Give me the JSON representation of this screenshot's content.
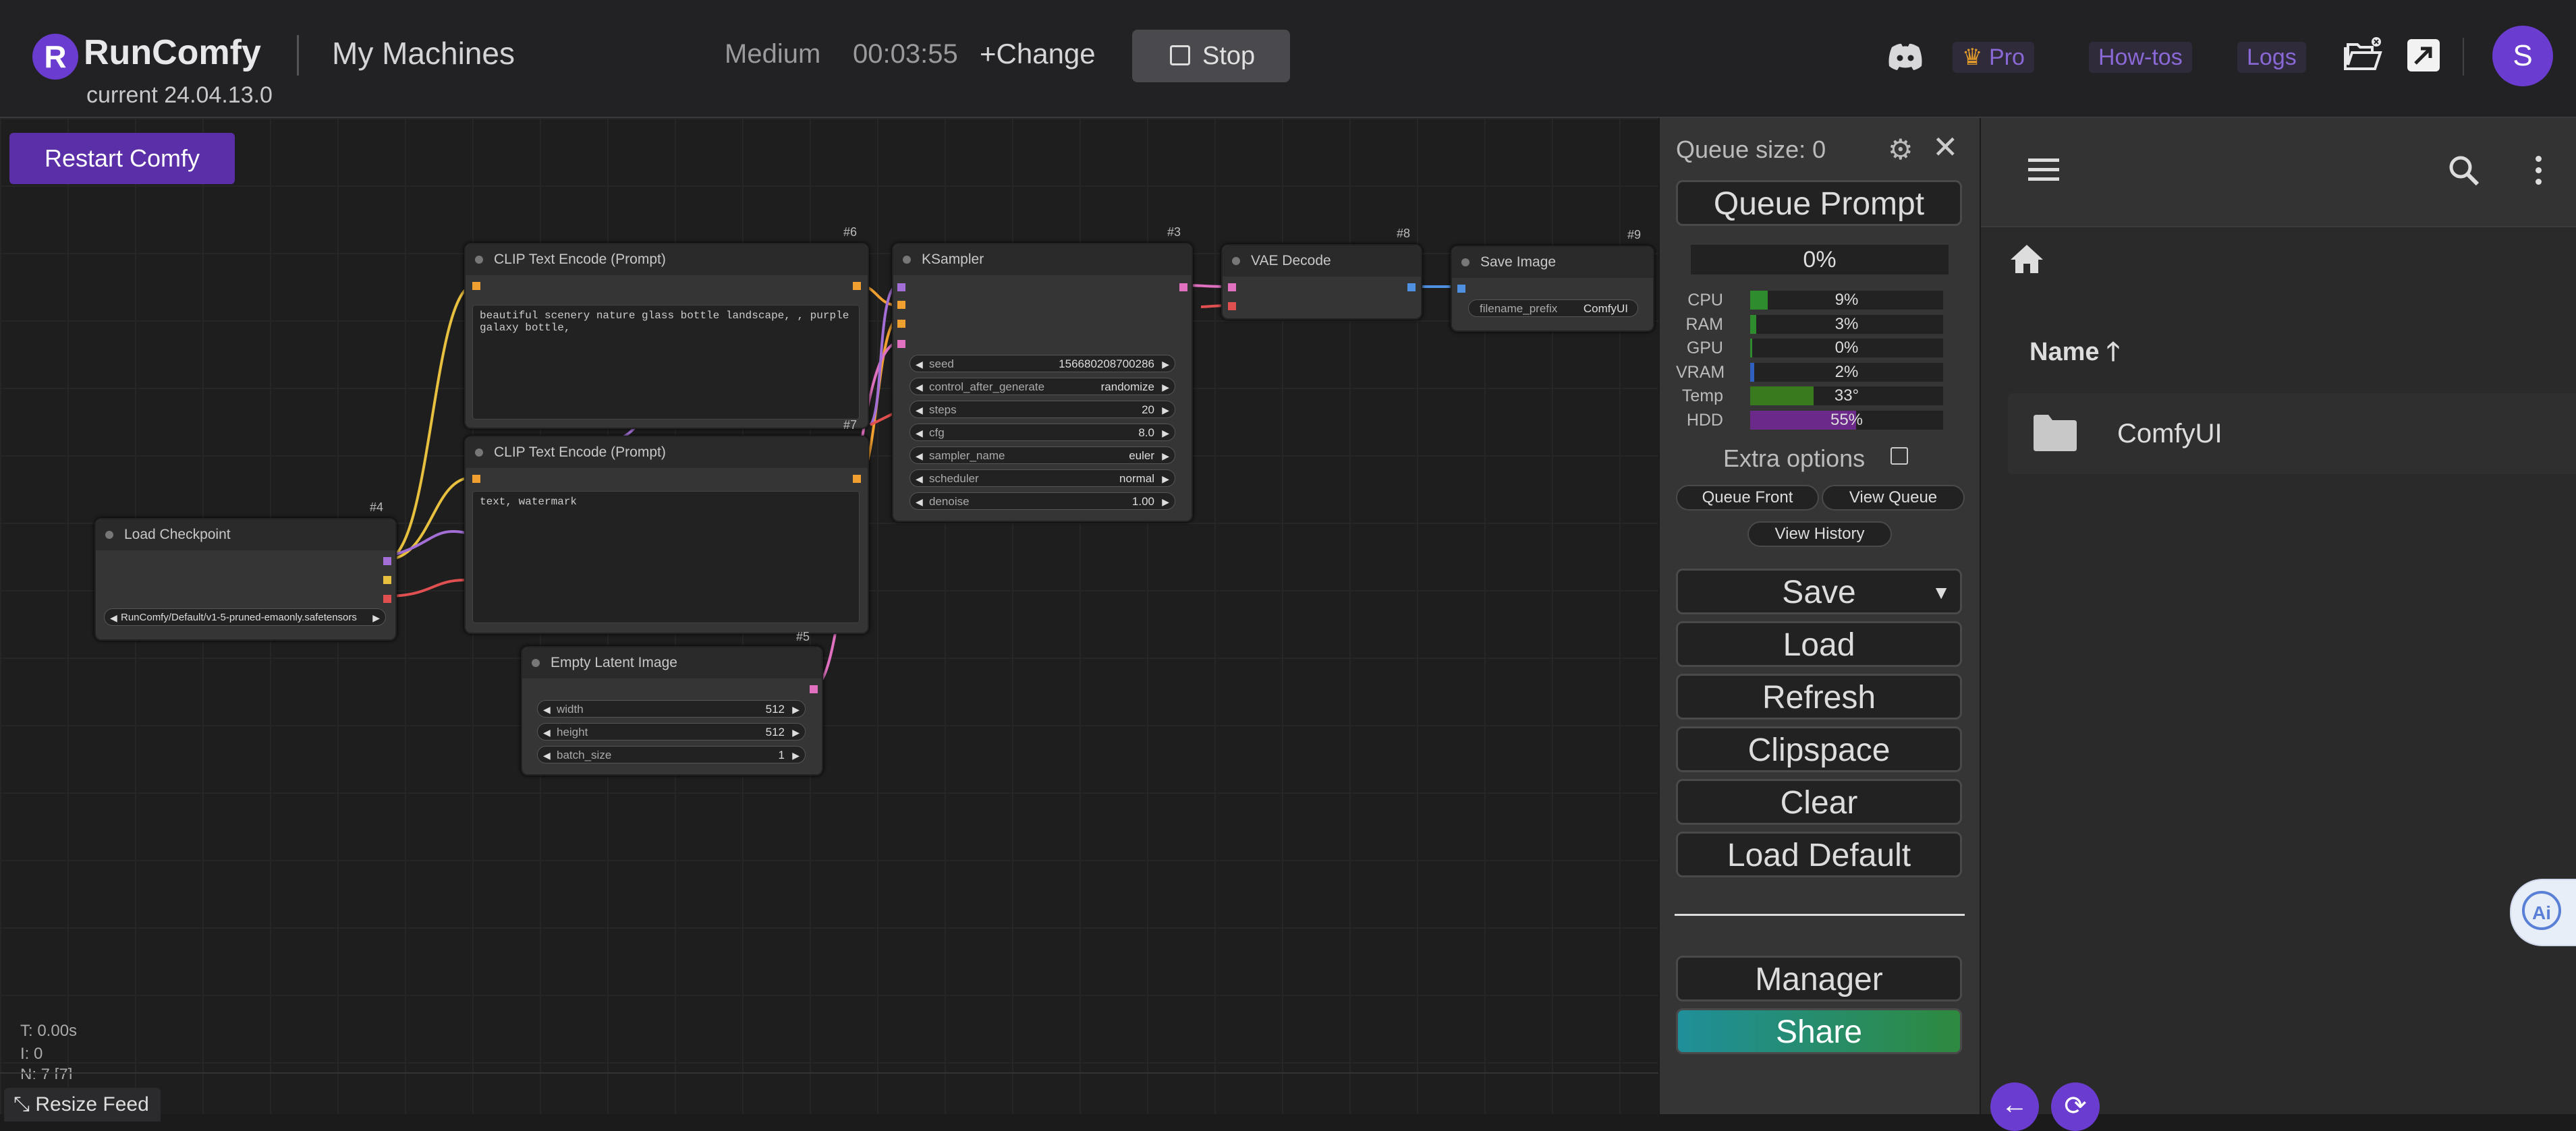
{
  "header": {
    "brand": "RunComfy",
    "logo_letter": "R",
    "page_title": "My Machines",
    "version": "current 24.04.13.0",
    "machine_size": "Medium",
    "timer": "00:03:55",
    "change_label": "+Change",
    "stop_label": "Stop",
    "pro_label": "Pro",
    "howtos_label": "How-tos",
    "logs_label": "Logs",
    "avatar_letter": "S",
    "accent": "#6a3ccf"
  },
  "canvas": {
    "restart_label": "Restart Comfy",
    "stats": [
      "T: 0.00s",
      "I: 0",
      "N: 7 [7]"
    ],
    "resize_feed_label": "Resize Feed",
    "nodes": {
      "clip1": {
        "title": "CLIP Text Encode (Prompt)",
        "id": "#6",
        "text": "beautiful scenery nature glass bottle landscape, , purple galaxy bottle,"
      },
      "clip2": {
        "title": "CLIP Text Encode (Prompt)",
        "id": "#7",
        "text": "text, watermark"
      },
      "ksampler": {
        "title": "KSampler",
        "id": "#3",
        "widgets": [
          {
            "label": "seed",
            "value": "156680208700286"
          },
          {
            "label": "control_after_generate",
            "value": "randomize"
          },
          {
            "label": "steps",
            "value": "20"
          },
          {
            "label": "cfg",
            "value": "8.0"
          },
          {
            "label": "sampler_name",
            "value": "euler"
          },
          {
            "label": "scheduler",
            "value": "normal"
          },
          {
            "label": "denoise",
            "value": "1.00"
          }
        ]
      },
      "vae": {
        "title": "VAE Decode",
        "id": "#8"
      },
      "save": {
        "title": "Save Image",
        "id": "#9",
        "widget_label": "filename_prefix",
        "widget_value": "ComfyUI"
      },
      "checkpoint": {
        "title": "Load Checkpoint",
        "id": "#4",
        "widget_value": "RunComfy/Default/v1-5-pruned-emaonly.safetensors"
      },
      "latent": {
        "title": "Empty Latent Image",
        "id": "#5",
        "widgets": [
          {
            "label": "width",
            "value": "512"
          },
          {
            "label": "height",
            "value": "512"
          },
          {
            "label": "batch_size",
            "value": "1"
          }
        ]
      }
    }
  },
  "queue": {
    "size_label": "Queue size: 0",
    "queue_prompt": "Queue Prompt",
    "progress": "0%",
    "resources": [
      {
        "label": "CPU",
        "value": "9%",
        "fill": 0.09,
        "color": "#2e8b2e"
      },
      {
        "label": "RAM",
        "value": "3%",
        "fill": 0.03,
        "color": "#2e8b2e"
      },
      {
        "label": "GPU",
        "value": "0%",
        "fill": 0.0,
        "color": "#2e8b2e"
      },
      {
        "label": "VRAM",
        "value": "2%",
        "fill": 0.02,
        "color": "#2f5fbf"
      },
      {
        "label": "Temp",
        "value": "33°",
        "fill": 0.33,
        "color": "#3a7a1e"
      },
      {
        "label": "HDD",
        "value": "55%",
        "fill": 0.55,
        "color": "#6b2a8a"
      }
    ],
    "extra_options": "Extra options",
    "queue_front": "Queue Front",
    "view_queue": "View Queue",
    "view_history": "View History",
    "buttons": [
      "Save",
      "Load",
      "Refresh",
      "Clipspace",
      "Clear",
      "Load Default"
    ],
    "manager": "Manager",
    "share": "Share"
  },
  "files": {
    "name_header": "Name",
    "items": [
      {
        "name": "ComfyUI",
        "icon": "folder-icon"
      }
    ]
  }
}
